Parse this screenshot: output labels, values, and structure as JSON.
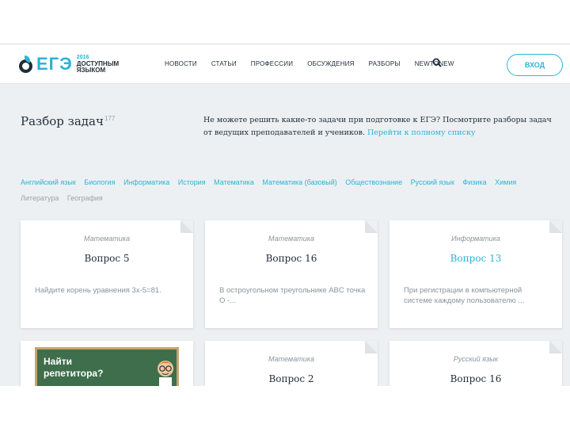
{
  "header": {
    "logo_text": "ЕГЭ",
    "logo_year": "2016",
    "logo_line1": "ДОСТУПНЫМ",
    "logo_line2": "ЯЗЫКОМ",
    "nav": [
      "НОВОСТИ",
      "СТАТЬИ",
      "ПРОФЕССИИ",
      "ОБСУЖДЕНИЯ",
      "РАЗБОРЫ",
      "NEWTONEW"
    ],
    "login_label": "ВХОД"
  },
  "page": {
    "title": "Разбор задач",
    "count": "177",
    "intro_text": "Не можете решить какие-то задачи при подготовке к ЕГЭ? Посмотрите разборы задач от ведущих преподавателей и учеников.",
    "intro_link": "Перейти к полному списку"
  },
  "subjects": [
    {
      "label": "Английский язык",
      "active": true
    },
    {
      "label": "Биология",
      "active": true
    },
    {
      "label": "Информатика",
      "active": true
    },
    {
      "label": "История",
      "active": true
    },
    {
      "label": "Математика",
      "active": true
    },
    {
      "label": "Математика (базовый)",
      "active": true
    },
    {
      "label": "Обществознание",
      "active": true
    },
    {
      "label": "Русский язык",
      "active": true
    },
    {
      "label": "Физика",
      "active": true
    },
    {
      "label": "Химия",
      "active": true
    },
    {
      "label": "Литература",
      "active": false
    },
    {
      "label": "География",
      "active": false
    }
  ],
  "cards": [
    {
      "subject": "Математика",
      "title": "Вопрос 5",
      "text": "Найдите корень уравнения 3x-5=81.",
      "highlight": false
    },
    {
      "subject": "Математика",
      "title": "Вопрос 16",
      "text": "В остроугольном треугольнике ABC точка O -...",
      "highlight": false
    },
    {
      "subject": "Информатика",
      "title": "Вопрос 13",
      "text": "При регистрации в компьютерной системе каждому пользователю ...",
      "highlight": true
    },
    {
      "subject": "Математика",
      "title": "Вопрос 2",
      "text": "",
      "highlight": false
    },
    {
      "subject": "Русский язык",
      "title": "Вопрос 16",
      "text": "",
      "highlight": false
    }
  ],
  "promo": {
    "line1": "Найти",
    "line2": "репетитора?"
  },
  "colors": {
    "accent": "#2bb3d9",
    "dark": "#1f2d3a",
    "muted": "#9aa3aa",
    "background": "#edf0f2"
  }
}
